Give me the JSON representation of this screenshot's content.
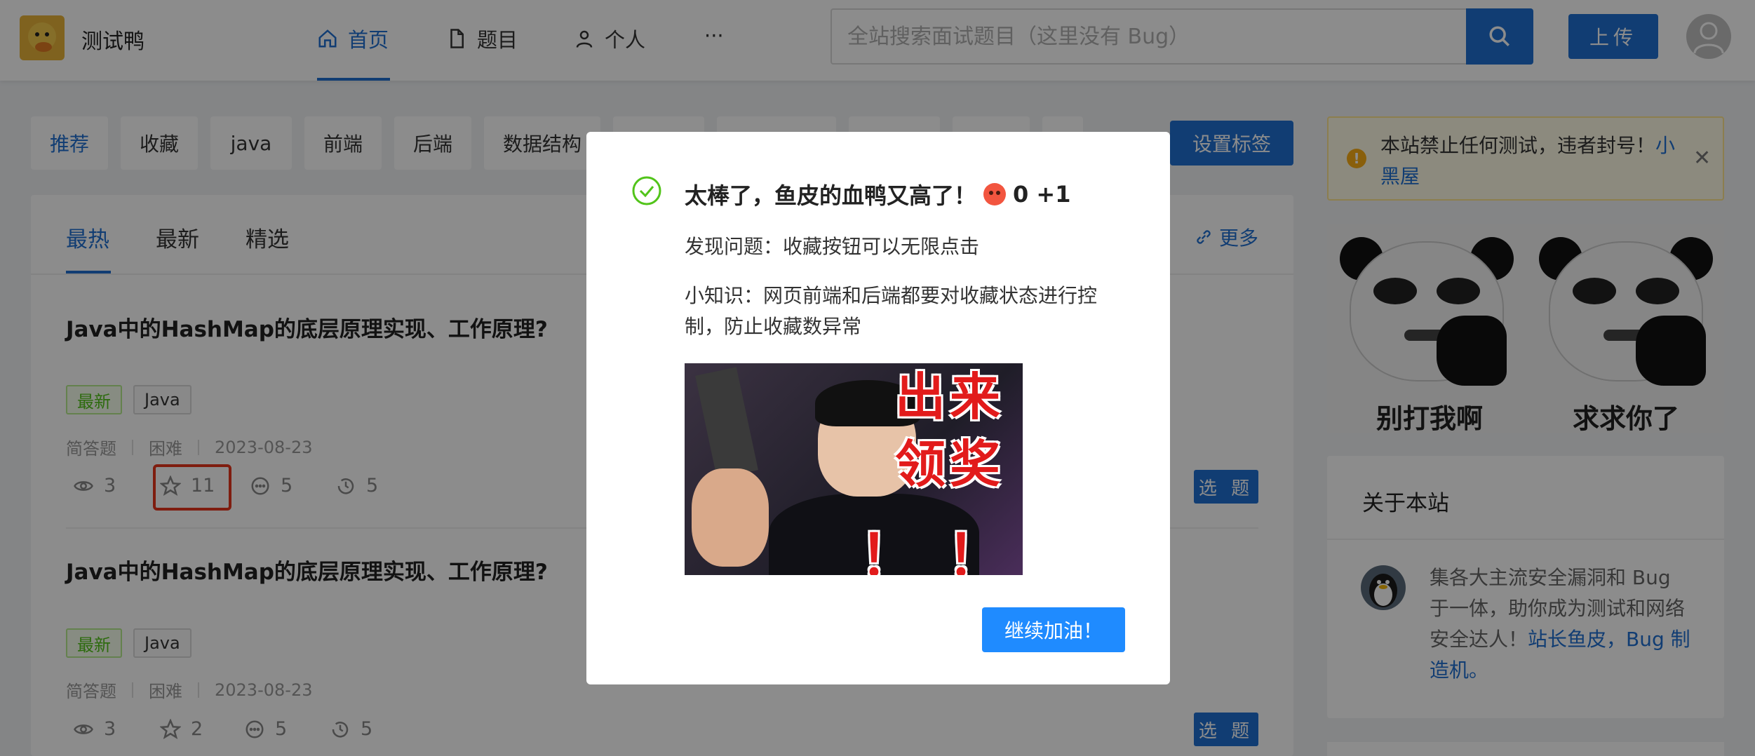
{
  "header": {
    "site_name": "测试鸭",
    "nav": [
      {
        "label": "首页",
        "icon": "home-icon",
        "active": true
      },
      {
        "label": "题目",
        "icon": "file-icon",
        "active": false
      },
      {
        "label": "个人",
        "icon": "user-icon",
        "active": false
      },
      {
        "label": "···",
        "icon": "ellipsis-icon",
        "active": false
      }
    ],
    "search_placeholder": "全站搜索面试题目（这里没有 Bug）",
    "upload_label": "上传"
  },
  "tagbar": {
    "tags": [
      "推荐",
      "收藏",
      "java",
      "前端",
      "后端",
      "数据结构"
    ],
    "set_tags_label": "设置标签"
  },
  "feed": {
    "tabs": [
      "最热",
      "最新",
      "精选"
    ],
    "more_label": "更多",
    "questions": [
      {
        "title": "Java中的HashMap的底层原理实现、工作原理?",
        "badges": [
          "最新",
          "Java"
        ],
        "type": "简答题",
        "difficulty": "困难",
        "date": "2023-08-23",
        "views": "3",
        "favorites": "11",
        "comments": "5",
        "history": "5",
        "select_label": "选 题"
      },
      {
        "title": "Java中的HashMap的底层原理实现、工作原理?",
        "badges": [
          "最新",
          "Java"
        ],
        "type": "简答题",
        "difficulty": "困难",
        "date": "2023-08-23",
        "views": "3",
        "favorites": "2",
        "comments": "5",
        "history": "5",
        "select_label": "选 题"
      }
    ]
  },
  "sidebar": {
    "notice_text": "本站禁止任何测试，违者封号！",
    "notice_link": "小黑屋",
    "meme_captions": [
      "别打我啊",
      "求求你了"
    ],
    "about_title": "关于本站",
    "about_text": "集各大主流安全漏洞和 Bug 于一体，助你成为测试和网络安全达人！",
    "about_link": "站长鱼皮，Bug 制造机。"
  },
  "modal": {
    "title": "太棒了，鱼皮的血鸭又高了！",
    "score": "0 +1",
    "problem": "发现问题：收藏按钮可以无限点击",
    "tip": "小知识：网页前端和后端都要对收藏状态进行控制，防止收藏数异常",
    "image_text_lines": [
      "出来",
      "领奖"
    ],
    "image_bangs": "！！！",
    "button_label": "继续加油！"
  },
  "colors": {
    "primary": "#1f6fd1",
    "success_check": "#52c41a",
    "highlight_red": "#e8351d"
  }
}
